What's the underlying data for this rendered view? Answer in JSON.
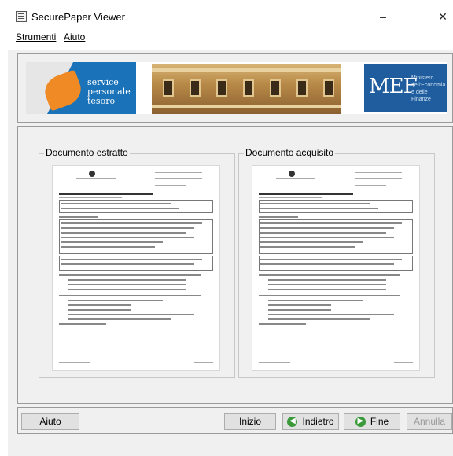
{
  "window": {
    "title": "SecurePaper Viewer",
    "minimize_glyph": "–",
    "close_glyph": "✕"
  },
  "menu": {
    "items": [
      "Strumenti",
      "Aiuto"
    ]
  },
  "banner": {
    "spt_words": [
      "service",
      "personale",
      "tesoro"
    ],
    "mef_text": "MEF",
    "mef_subtitle": [
      "Ministero",
      "dell'Economia",
      "e delle Finanze"
    ]
  },
  "documents": {
    "left_title": "Documento estratto",
    "right_title": "Documento acquisito"
  },
  "buttons": {
    "help": "Aiuto",
    "start": "Inizio",
    "back": "Indietro",
    "end": "Fine",
    "cancel": "Annulla"
  },
  "colors": {
    "accent_green": "#3a9a3a",
    "mef_blue": "#1f5d9e",
    "spt_blue": "#1a73b8",
    "spt_orange": "#f08a24"
  },
  "icons": {
    "back": "arrow-left-circle-icon",
    "end": "arrow-right-circle-icon"
  }
}
